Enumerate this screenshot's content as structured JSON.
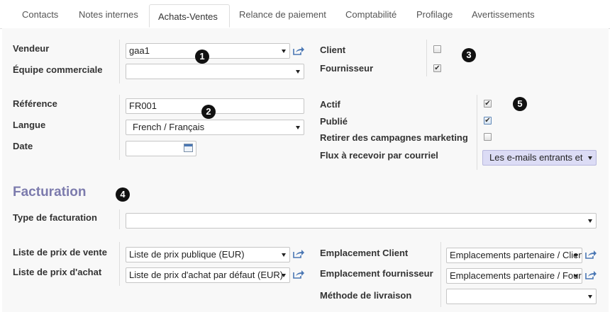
{
  "tabs": [
    "Contacts",
    "Notes internes",
    "Achats-Ventes",
    "Relance de paiement",
    "Comptabilité",
    "Profilage",
    "Avertissements"
  ],
  "active_tab": "Achats-Ventes",
  "sales": {
    "vendeur_label": "Vendeur",
    "vendeur_value": "gaa1",
    "equipe_label": "Équipe commerciale",
    "equipe_value": ""
  },
  "flags": {
    "client_label": "Client",
    "client_checked": false,
    "fournisseur_label": "Fournisseur",
    "fournisseur_checked": true
  },
  "details": {
    "reference_label": "Référence",
    "reference_value": "FR001",
    "langue_label": "Langue",
    "langue_value": "French / Français",
    "date_label": "Date",
    "date_value": ""
  },
  "status": {
    "actif_label": "Actif",
    "actif_checked": true,
    "publie_label": "Publié",
    "publie_checked": true,
    "retirer_label": "Retirer des campagnes marketing",
    "retirer_checked": false,
    "flux_label": "Flux à recevoir par courriel",
    "flux_value": "Les e-mails entrants et"
  },
  "facturation": {
    "title": "Facturation",
    "type_label": "Type de facturation",
    "type_value": "",
    "prix_vente_label": "Liste de prix de vente",
    "prix_vente_value": "Liste de prix publique (EUR)",
    "prix_achat_label": "Liste de prix d'achat",
    "prix_achat_value": "Liste de prix d'achat par défaut (EUR)",
    "empl_client_label": "Emplacement Client",
    "empl_client_value": "Emplacements partenaire / Clients",
    "empl_fourn_label": "Emplacement fournisseur",
    "empl_fourn_value": "Emplacements partenaire / Fournisseurs",
    "methode_label": "Méthode de livraison",
    "methode_value": ""
  },
  "badges": [
    "1",
    "2",
    "3",
    "4",
    "5"
  ],
  "colors": {
    "section_title": "#7c7bad",
    "flux_bg": "#dcdcf5"
  }
}
